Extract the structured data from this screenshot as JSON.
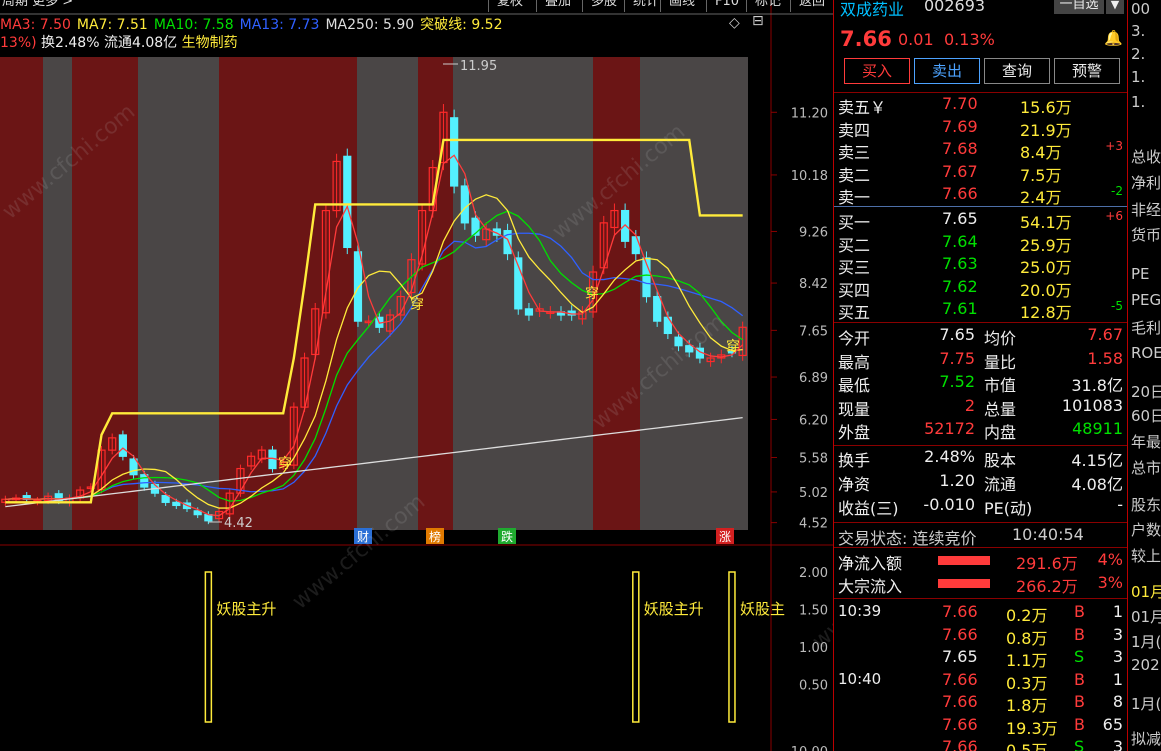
{
  "top_bar": {
    "left_text": "周期 更多 >",
    "right_items": [
      "复权",
      "叠加",
      "多股",
      "统计",
      "画线",
      "F10",
      "标记",
      "返回"
    ]
  },
  "ma_line": [
    {
      "label": "MA3: 7.50",
      "color": "#ff3b3b"
    },
    {
      "label": "MA7: 7.51",
      "color": "#ffeb3b"
    },
    {
      "label": "MA10: 7.58",
      "color": "#00e000"
    },
    {
      "label": "MA13: 7.73",
      "color": "#3060ff"
    },
    {
      "label": "MA250: 5.90",
      "color": "#dddddd"
    },
    {
      "label": "突破线: 9.52",
      "color": "#ffeb3b"
    }
  ],
  "info_line": {
    "pct": "13%)",
    "turnover": "换2.48%",
    "float": "流通4.08亿",
    "sector": "生物制药"
  },
  "price_axis": [
    "11.20",
    "10.18",
    "9.26",
    "8.42",
    "7.65",
    "6.89",
    "6.20",
    "5.58",
    "5.02",
    "4.52"
  ],
  "price_annotations": {
    "high": "11.95",
    "low": "4.42"
  },
  "event_markers": [
    {
      "label": "财",
      "color": "#2a6fd6"
    },
    {
      "label": "榜",
      "color": "#e07a00"
    },
    {
      "label": "跌",
      "color": "#1faa2f"
    },
    {
      "label": "涨",
      "color": "#d32020"
    }
  ],
  "signal_label": "穿",
  "indicator_axis": [
    "2.00",
    "1.50",
    "1.00",
    "0.50"
  ],
  "indicator_labels": [
    "妖股主升",
    "妖股主升",
    "妖股主"
  ],
  "bottom_axis_label": "10.00",
  "watermark": "www.cfchi.com",
  "chart_data": {
    "type": "candlestick",
    "series": [
      {
        "name": "MA3",
        "color": "#ff3b3b"
      },
      {
        "name": "MA7",
        "color": "#ffeb3b"
      },
      {
        "name": "MA10",
        "color": "#00e000"
      },
      {
        "name": "MA13",
        "color": "#3060ff"
      },
      {
        "name": "MA250",
        "color": "#dddddd"
      },
      {
        "name": "突破线",
        "color": "#ffeb3b"
      }
    ],
    "close": [
      4.9,
      4.92,
      4.9,
      4.88,
      4.95,
      4.88,
      4.92,
      5.05,
      5.1,
      5.7,
      5.9,
      5.6,
      5.3,
      5.1,
      5.0,
      4.85,
      4.8,
      4.75,
      4.65,
      4.55,
      4.7,
      5.0,
      5.4,
      5.6,
      5.7,
      5.4,
      5.5,
      6.4,
      7.2,
      8.0,
      9.6,
      10.4,
      9.0,
      7.8,
      7.8,
      7.7,
      7.9,
      8.2,
      8.8,
      9.6,
      10.3,
      11.2,
      10.0,
      9.4,
      9.2,
      9.3,
      9.2,
      8.9,
      8.0,
      7.9,
      8.0,
      7.95,
      7.9,
      7.9,
      7.95,
      8.6,
      9.4,
      9.6,
      9.1,
      8.9,
      8.2,
      7.8,
      7.6,
      7.4,
      7.3,
      7.2,
      7.2,
      7.25,
      7.3,
      7.7
    ],
    "breakout_line": [
      4.85,
      4.85,
      4.85,
      4.85,
      4.85,
      4.85,
      4.85,
      4.85,
      4.85,
      5.95,
      6.3,
      6.3,
      6.3,
      6.3,
      6.3,
      6.3,
      6.3,
      6.3,
      6.3,
      6.3,
      6.3,
      6.3,
      6.3,
      6.3,
      6.3,
      6.3,
      6.3,
      7.2,
      8.4,
      9.7,
      9.7,
      9.7,
      9.7,
      9.7,
      9.7,
      9.7,
      9.7,
      9.7,
      9.7,
      9.7,
      9.7,
      10.75,
      10.75,
      10.75,
      10.75,
      10.75,
      10.75,
      10.75,
      10.75,
      10.75,
      10.75,
      10.75,
      10.75,
      10.75,
      10.75,
      10.75,
      10.75,
      10.75,
      10.75,
      10.75,
      10.75,
      10.75,
      10.75,
      10.75,
      10.75,
      9.52,
      9.52,
      9.52,
      9.52,
      9.52
    ],
    "indicator": [
      {
        "x": 19,
        "value": 2.0
      },
      {
        "x": 59,
        "value": 2.0
      },
      {
        "x": 68,
        "value": 2.0
      }
    ],
    "ylim": [
      4.4,
      12.1
    ]
  },
  "stock": {
    "name": "双成药业",
    "code": "002693",
    "filter_btn": "一自选",
    "price": "7.66",
    "change": "0.01",
    "pct": "0.13%"
  },
  "actions": [
    "买入",
    "卖出",
    "查询",
    "预警"
  ],
  "order_book": {
    "asks": [
      {
        "label": "卖五￥",
        "price": "7.70",
        "vol": "15.6万",
        "delta": ""
      },
      {
        "label": "卖四",
        "price": "7.69",
        "vol": "21.9万",
        "delta": ""
      },
      {
        "label": "卖三",
        "price": "7.68",
        "vol": "8.4万",
        "delta": "+3"
      },
      {
        "label": "卖二",
        "price": "7.67",
        "vol": "7.5万",
        "delta": ""
      },
      {
        "label": "卖一",
        "price": "7.66",
        "vol": "2.4万",
        "delta": "-2"
      }
    ],
    "bids": [
      {
        "label": "买一",
        "price": "7.65",
        "vol": "54.1万",
        "delta": "+6"
      },
      {
        "label": "买二",
        "price": "7.64",
        "vol": "25.9万",
        "delta": ""
      },
      {
        "label": "买三",
        "price": "7.63",
        "vol": "25.0万",
        "delta": ""
      },
      {
        "label": "买四",
        "price": "7.62",
        "vol": "20.0万",
        "delta": ""
      },
      {
        "label": "买五",
        "price": "7.61",
        "vol": "12.8万",
        "delta": "-5"
      }
    ]
  },
  "quote": [
    {
      "l1": "今开",
      "v1": "7.65",
      "c1": "white",
      "l2": "均价",
      "v2": "7.67",
      "c2": "red"
    },
    {
      "l1": "最高",
      "v1": "7.75",
      "c1": "red",
      "l2": "量比",
      "v2": "1.58",
      "c2": "red"
    },
    {
      "l1": "最低",
      "v1": "7.52",
      "c1": "green",
      "l2": "市值",
      "v2": "31.8亿",
      "c2": "white"
    },
    {
      "l1": "现量",
      "v1": "2",
      "c1": "red",
      "l2": "总量",
      "v2": "101083",
      "c2": "white"
    },
    {
      "l1": "外盘",
      "v1": "52172",
      "c1": "red",
      "l2": "内盘",
      "v2": "48911",
      "c2": "green"
    }
  ],
  "fundamentals": [
    {
      "l1": "换手",
      "v1": "2.48%",
      "l2": "股本",
      "v2": "4.15亿"
    },
    {
      "l1": "净资",
      "v1": "1.20",
      "l2": "流通",
      "v2": "4.08亿"
    },
    {
      "l1": "收益(三)",
      "v1": "-0.010",
      "l2": "PE(动)",
      "v2": "-"
    }
  ],
  "trade_status": {
    "label": "交易状态: 连续竞价",
    "time": "10:40:54"
  },
  "flows": [
    {
      "label": "净流入额",
      "value": "291.6万",
      "pct": "4%"
    },
    {
      "label": "大宗流入",
      "value": "266.2万",
      "pct": "3%"
    }
  ],
  "ticks": [
    {
      "time": "10:39",
      "price": "7.66",
      "vol": "0.2万",
      "side": "B",
      "count": "1",
      "pc": "red"
    },
    {
      "time": "",
      "price": "7.66",
      "vol": "0.8万",
      "side": "B",
      "count": "3",
      "pc": "red"
    },
    {
      "time": "",
      "price": "7.65",
      "vol": "1.1万",
      "side": "S",
      "count": "3",
      "pc": "white"
    },
    {
      "time": "10:40",
      "price": "7.66",
      "vol": "0.3万",
      "side": "B",
      "count": "1",
      "pc": "red"
    },
    {
      "time": "",
      "price": "7.66",
      "vol": "1.8万",
      "side": "B",
      "count": "8",
      "pc": "red"
    },
    {
      "time": "",
      "price": "7.66",
      "vol": "19.3万",
      "side": "B",
      "count": "65",
      "pc": "red"
    },
    {
      "time": "",
      "price": "7.66",
      "vol": "0.5万",
      "side": "S",
      "count": "3",
      "pc": "red"
    }
  ],
  "far_right": [
    "00",
    "3.",
    "2.",
    "1.",
    "1.",
    "总收",
    "净利",
    "非经",
    "货币",
    "PE",
    "PEG",
    "毛利",
    "ROE",
    "20日",
    "60日",
    "年最",
    "总市",
    "股东",
    "户数",
    "较上",
    "01月",
    "01月",
    "1月(",
    "202",
    "1月(",
    "拟减"
  ]
}
